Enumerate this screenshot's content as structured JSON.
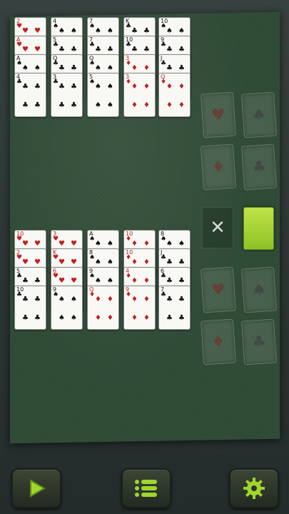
{
  "game": {
    "undo_label": "✕",
    "top_tableau": [
      [
        {
          "rank": "2",
          "suit": "♥",
          "color": "red"
        },
        {
          "rank": "A",
          "suit": "♥",
          "color": "red"
        },
        {
          "rank": "A",
          "suit": "♠",
          "color": "blk"
        },
        {
          "rank": "4",
          "suit": "♣",
          "color": "blk"
        }
      ],
      [
        {
          "rank": "4",
          "suit": "♠",
          "color": "blk"
        },
        {
          "rank": "5",
          "suit": "♣",
          "color": "blk"
        },
        {
          "rank": "Q",
          "suit": "♣",
          "color": "blk"
        },
        {
          "rank": "3",
          "suit": "♣",
          "color": "blk"
        }
      ],
      [
        {
          "rank": "7",
          "suit": "♠",
          "color": "blk"
        },
        {
          "rank": "7",
          "suit": "♣",
          "color": "blk"
        },
        {
          "rank": "Q",
          "suit": "♠",
          "color": "blk"
        },
        {
          "rank": "5",
          "suit": "♠",
          "color": "blk"
        }
      ],
      [
        {
          "rank": "K",
          "suit": "♣",
          "color": "blk"
        },
        {
          "rank": "10",
          "suit": "♣",
          "color": "blk"
        },
        {
          "rank": "3",
          "suit": "♦",
          "color": "red"
        },
        {
          "rank": "3",
          "suit": "♦",
          "color": "red"
        }
      ],
      [
        {
          "rank": "10",
          "suit": "♠",
          "color": "blk"
        },
        {
          "rank": "9",
          "suit": "♣",
          "color": "blk"
        },
        {
          "rank": "J",
          "suit": "♣",
          "color": "blk"
        },
        {
          "rank": "Q",
          "suit": "♦",
          "color": "red"
        }
      ]
    ],
    "bottom_tableau": [
      [
        {
          "rank": "10",
          "suit": "♥",
          "color": "red"
        },
        {
          "rank": "2",
          "suit": "♥",
          "color": "red"
        },
        {
          "rank": "5",
          "suit": "♣",
          "color": "blk"
        },
        {
          "rank": "10",
          "suit": "♣",
          "color": "blk"
        }
      ],
      [
        {
          "rank": "3",
          "suit": "♥",
          "color": "red"
        },
        {
          "rank": "K",
          "suit": "♥",
          "color": "red"
        },
        {
          "rank": "6",
          "suit": "♥",
          "color": "red"
        },
        {
          "rank": "9",
          "suit": "♠",
          "color": "blk"
        }
      ],
      [
        {
          "rank": "A",
          "suit": "♠",
          "color": "blk"
        },
        {
          "rank": "8",
          "suit": "♠",
          "color": "blk"
        },
        {
          "rank": "9",
          "suit": "♠",
          "color": "blk"
        },
        {
          "rank": "Q",
          "suit": "♦",
          "color": "red"
        }
      ],
      [
        {
          "rank": "10",
          "suit": "♦",
          "color": "red"
        },
        {
          "rank": "10",
          "suit": "♦",
          "color": "red"
        },
        {
          "rank": "4",
          "suit": "♦",
          "color": "red"
        },
        {
          "rank": "9",
          "suit": "♦",
          "color": "red"
        }
      ],
      [
        {
          "rank": "8",
          "suit": "♠",
          "color": "blk"
        },
        {
          "rank": "J",
          "suit": "♣",
          "color": "blk"
        },
        {
          "rank": "6",
          "suit": "♣",
          "color": "blk"
        },
        {
          "rank": "7",
          "suit": "♣",
          "color": "blk"
        }
      ]
    ],
    "foundations_top": [
      "♥",
      "♠",
      "♦",
      "♣"
    ],
    "foundations_bottom": [
      "♥",
      "♠",
      "♦",
      "♣"
    ],
    "colors": {
      "felt": "#2e4a35",
      "stock": "#a8d43a",
      "card_red": "#c0201f",
      "card_black": "#111111"
    },
    "buttons": [
      {
        "name": "play-button",
        "icon": "play-icon"
      },
      {
        "name": "menu-button",
        "icon": "list-icon"
      },
      {
        "name": "settings-button",
        "icon": "gear-icon"
      }
    ]
  }
}
